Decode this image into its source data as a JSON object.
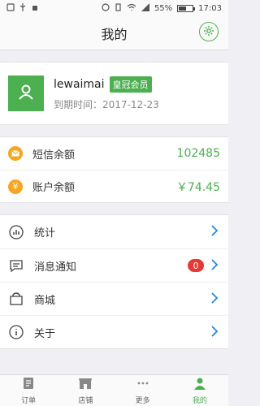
{
  "status_bar": {
    "battery": "55%",
    "battery_level": 0.55,
    "time": "17:03"
  },
  "header": {
    "title": "我的"
  },
  "profile": {
    "username": "lewaimai",
    "badge": "皇冠会员",
    "expire_label": "到期时间：",
    "expire_date": "2017-12-23"
  },
  "balance": {
    "sms_label": "短信余额",
    "sms_value": "102485",
    "account_label": "账户余额",
    "account_value": "￥74.45"
  },
  "menu": {
    "items": [
      {
        "label": "统计",
        "icon": "chart-icon"
      },
      {
        "label": "消息通知",
        "icon": "message-icon",
        "badge": "0"
      },
      {
        "label": "商城",
        "icon": "shop-bag-icon"
      },
      {
        "label": "关于",
        "icon": "info-icon"
      }
    ]
  },
  "bottom_nav": {
    "items": [
      {
        "label": "订单",
        "icon": "order-icon"
      },
      {
        "label": "店铺",
        "icon": "store-icon"
      },
      {
        "label": "更多",
        "icon": "more-icon"
      },
      {
        "label": "我的",
        "icon": "user-icon",
        "active": true
      }
    ]
  },
  "colors": {
    "accent": "#4caf50",
    "coin": "#f5a623",
    "badge_red": "#e53935",
    "chevron": "#1e88e5"
  }
}
